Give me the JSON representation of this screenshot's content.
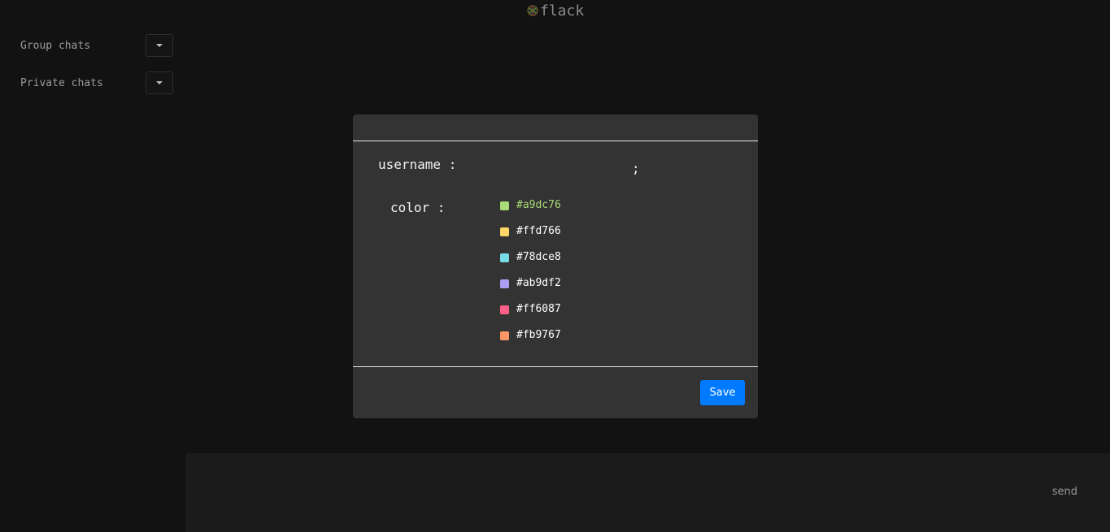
{
  "app": {
    "title": "flack",
    "logo_icon": "checkered-ball-icon"
  },
  "sidebar": {
    "items": [
      {
        "label": "Group chats",
        "toggle_icon": "chevron-down-icon"
      },
      {
        "label": "Private chats",
        "toggle_icon": "chevron-down-icon"
      }
    ]
  },
  "modal": {
    "username_label": "username :",
    "username_value": ";",
    "color_label": "color :",
    "colors": [
      {
        "label": "#a9dc76",
        "hex": "#a9dc76",
        "selected": true
      },
      {
        "label": "#ffd766",
        "hex": "#ffd766",
        "selected": false
      },
      {
        "label": "#78dce8",
        "hex": "#78dce8",
        "selected": false
      },
      {
        "label": "#ab9df2",
        "hex": "#ab9df2",
        "selected": false
      },
      {
        "label": "#ff6087",
        "hex": "#ff6087",
        "selected": false
      },
      {
        "label": "#fb9767",
        "hex": "#fb9767",
        "selected": false
      }
    ],
    "save_label": "Save",
    "save_color": "#007bff"
  },
  "composer": {
    "send_label": "send"
  }
}
